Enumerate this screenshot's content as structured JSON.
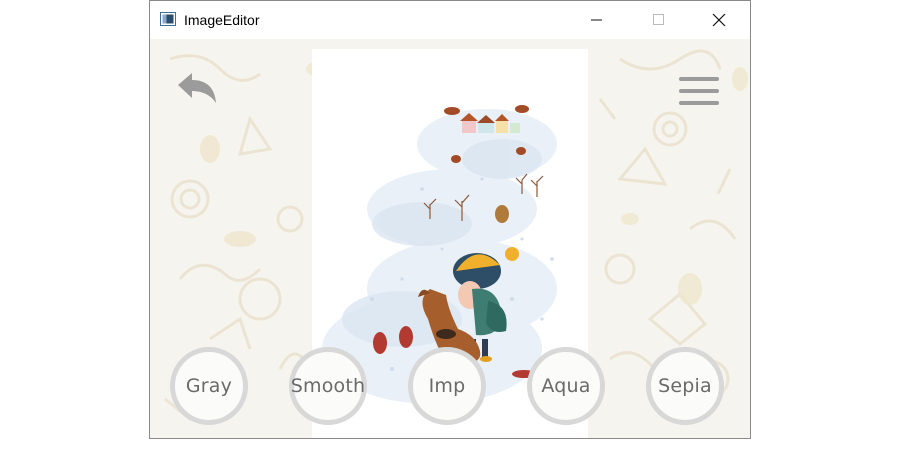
{
  "window": {
    "title": "ImageEditor"
  },
  "toolbar": {
    "back_icon": "undo-arrow-icon",
    "menu_icon": "hamburger-menu-icon"
  },
  "image": {
    "description_icon": "winter-illustration"
  },
  "filters": [
    {
      "label": "Gray"
    },
    {
      "label": "Smooth"
    },
    {
      "label": "Imp"
    },
    {
      "label": "Aqua"
    },
    {
      "label": "Sepia"
    }
  ],
  "colors": {
    "accent_gray": "#9b9b9b",
    "button_border": "#d8d8d8",
    "background": "#f6f4ee"
  }
}
